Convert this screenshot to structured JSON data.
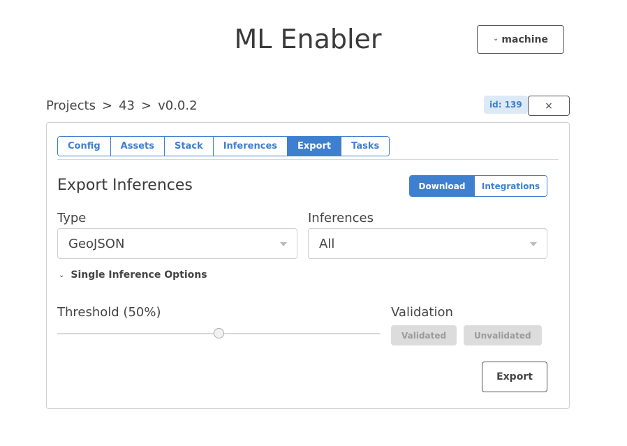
{
  "app": {
    "title": "ML Enabler"
  },
  "user_menu": {
    "label": "machine",
    "icon": "chevron-down-icon"
  },
  "breadcrumb": {
    "items": [
      "Projects",
      "43",
      "v0.0.2"
    ],
    "separator": ">"
  },
  "model": {
    "id_label": "id: 139"
  },
  "close_button": {
    "label": "×"
  },
  "tabs": [
    {
      "label": "Config",
      "active": false
    },
    {
      "label": "Assets",
      "active": false
    },
    {
      "label": "Stack",
      "active": false
    },
    {
      "label": "Inferences",
      "active": false
    },
    {
      "label": "Export",
      "active": true
    },
    {
      "label": "Tasks",
      "active": false
    }
  ],
  "export": {
    "title": "Export Inferences",
    "mode_toggle": [
      {
        "label": "Download",
        "active": true
      },
      {
        "label": "Integrations",
        "active": false
      }
    ],
    "type_field": {
      "label": "Type",
      "value": "GeoJSON"
    },
    "inferences_field": {
      "label": "Inferences",
      "value": "All"
    },
    "single_options": {
      "label": "Single Inference Options",
      "expanded": true
    },
    "threshold": {
      "label": "Threshold (50%)",
      "value": 0.5
    },
    "validation": {
      "label": "Validation",
      "options": [
        "Validated",
        "Unvalidated"
      ]
    },
    "export_button": "Export"
  },
  "colors": {
    "accent": "#3f7fd0",
    "badge_bg": "#dce9f7",
    "disabled_bg": "#dcdcdc"
  }
}
